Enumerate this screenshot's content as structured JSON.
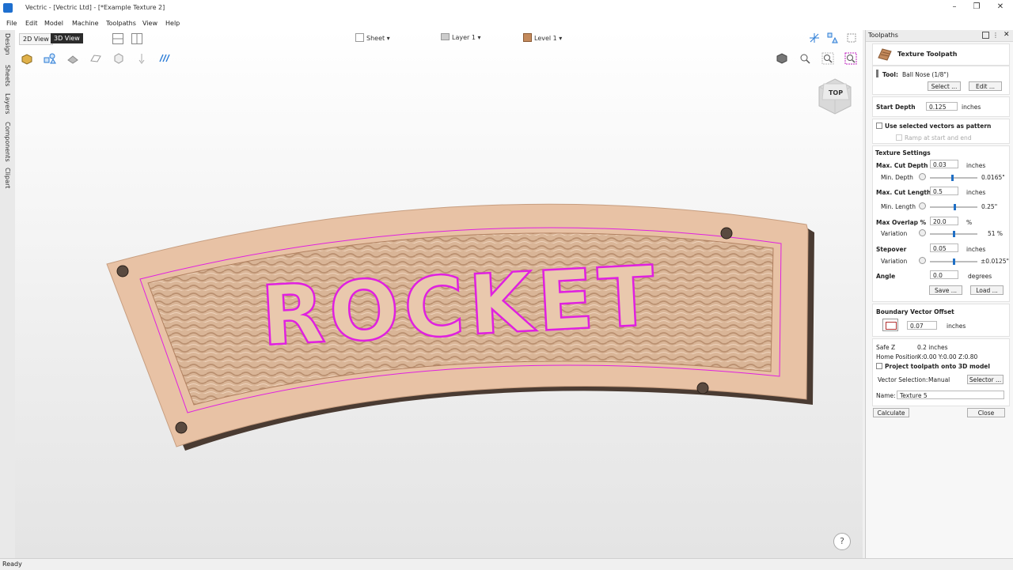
{
  "window": {
    "title": "Vectric - [Vectric Ltd] - [*Example Texture 2]",
    "controls": {
      "minimize": "–",
      "restore": "❐",
      "close": "✕"
    }
  },
  "menu": [
    "File",
    "Edit",
    "Model",
    "Machine",
    "Toolpaths",
    "View",
    "Help"
  ],
  "left_tabs": [
    "Design",
    "Sheets",
    "Layers",
    "Components",
    "Clipart"
  ],
  "view_toggle": {
    "view2d": "2D View",
    "view3d": "3D View"
  },
  "dropdowns": {
    "sheet": "Sheet ▾",
    "layer": "Layer 1 ▾",
    "level": "Level 1 ▾"
  },
  "nav_cube": {
    "face": "TOP"
  },
  "model": {
    "text": "ROCKET",
    "outline_color": "#e020e0",
    "wood_color": "#e8c2a5"
  },
  "help": "?",
  "status": "Ready",
  "panel": {
    "header": "Toolpaths",
    "title": "Texture Toolpath",
    "tool_label": "Tool:",
    "tool_value": "Ball Nose (1/8\")",
    "select_btn": "Select ...",
    "edit_btn": "Edit ...",
    "start_depth_label": "Start Depth",
    "start_depth_value": "0.125",
    "start_depth_unit": "inches",
    "use_vectors_label": "Use selected vectors as pattern",
    "ramp_label": "Ramp at start and end",
    "texture_settings": "Texture Settings",
    "max_cut_depth_label": "Max. Cut Depth",
    "max_cut_depth_value": "0.03",
    "max_cut_depth_unit": "inches",
    "min_depth_label": "Min. Depth",
    "min_depth_value": "0.0165\"",
    "max_cut_length_label": "Max. Cut Length",
    "max_cut_length_value": "0.5",
    "max_cut_length_unit": "inches",
    "min_length_label": "Min. Length",
    "min_length_value": "0.25\"",
    "max_overlap_label": "Max Overlap %",
    "max_overlap_value": "20.0",
    "max_overlap_unit": "%",
    "variation1_label": "Variation",
    "variation1_value": "51 %",
    "stepover_label": "Stepover",
    "stepover_value": "0.05",
    "stepover_unit": "inches",
    "variation2_label": "Variation",
    "variation2_value": "±0.0125\"",
    "angle_label": "Angle",
    "angle_value": "0.0",
    "angle_unit": "degrees",
    "save_btn": "Save ...",
    "load_btn": "Load ...",
    "boundary_label": "Boundary Vector Offset",
    "boundary_value": "0.07",
    "boundary_unit": "inches",
    "safe_z_label": "Safe Z",
    "safe_z_value": "0.2 inches",
    "home_label": "Home Position",
    "home_value": "X:0.00 Y:0.00 Z:0.80",
    "project_label": "Project toolpath onto 3D model",
    "vector_sel_label": "Vector Selection:",
    "vector_sel_value": "Manual",
    "selector_btn": "Selector ...",
    "name_label": "Name:",
    "name_value": "Texture 5",
    "calculate_btn": "Calculate",
    "close_btn": "Close"
  },
  "colors": {
    "accent": "#1f6fc5",
    "view3d_bg": "#2b2b2b",
    "outline": "#e020e0"
  }
}
